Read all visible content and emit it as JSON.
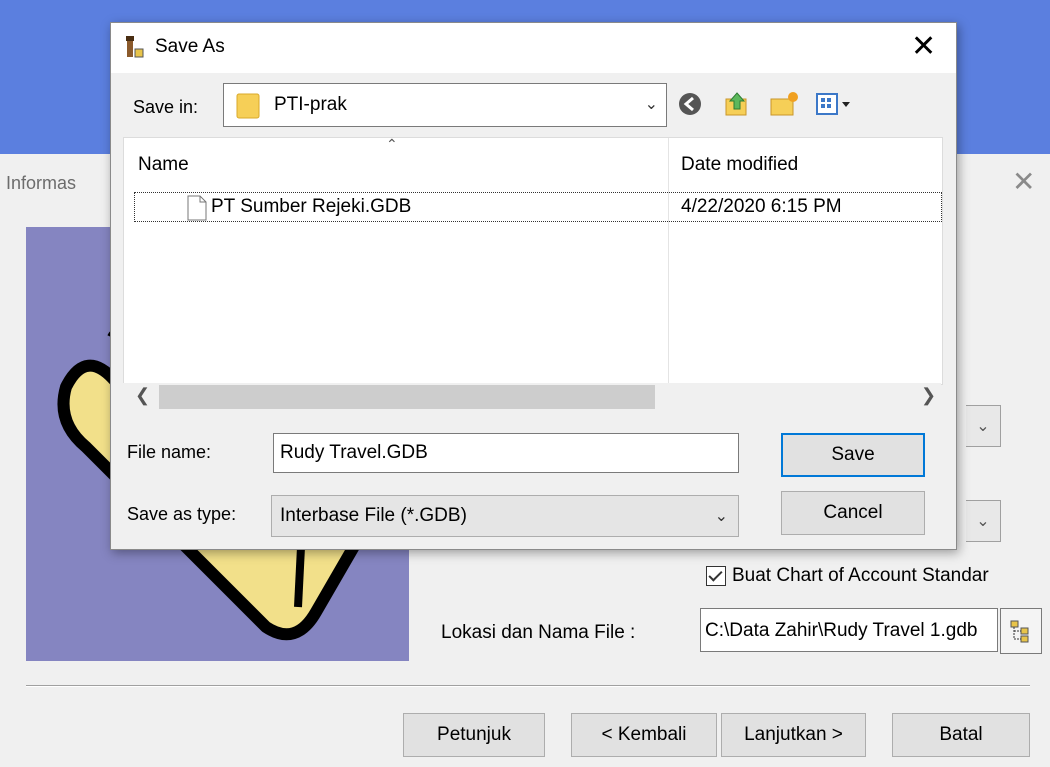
{
  "wizard": {
    "title": "Informas",
    "close_glyph": "✕",
    "checkbox_label": "Buat Chart of Account Standar",
    "checkbox_checked": true,
    "location_label": "Lokasi dan Nama File :",
    "location_value": "C:\\Data Zahir\\Rudy Travel 1.gdb",
    "buttons": {
      "help": "Petunjuk",
      "back": "< Kembali",
      "next": "Lanjutkan >",
      "cancel": "Batal"
    },
    "colors": {
      "titlebar": "#5b7fdf",
      "illustration_bg": "#8585c1"
    }
  },
  "dialog": {
    "title": "Save As",
    "close_glyph": "✕",
    "save_in_label": "Save in:",
    "save_in_value": "PTI-prak",
    "columns": {
      "name": "Name",
      "date": "Date modified"
    },
    "files": [
      {
        "name": "PT Sumber Rejeki.GDB",
        "date": "4/22/2020 6:15 PM"
      }
    ],
    "file_name_label": "File name:",
    "file_name_value": "Rudy Travel.GDB",
    "save_type_label": "Save as type:",
    "save_type_value": "Interbase File (*.GDB)",
    "save_button": "Save",
    "cancel_button": "Cancel",
    "toolbar_icons": [
      "back-icon",
      "up-folder-icon",
      "new-folder-icon",
      "view-menu-icon"
    ]
  }
}
